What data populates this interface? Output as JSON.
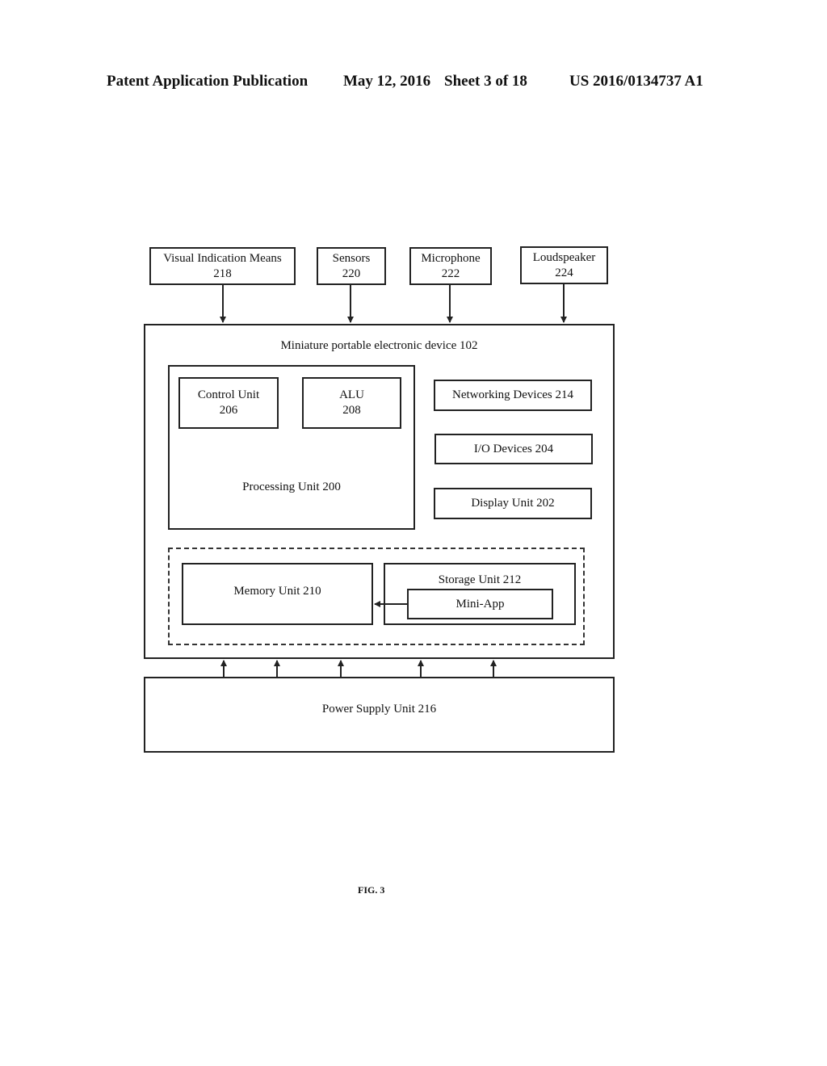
{
  "header": {
    "publication": "Patent Application Publication",
    "date": "May 12, 2016",
    "sheet": "Sheet 3 of 18",
    "number": "US 2016/0134737 A1"
  },
  "inputs": [
    {
      "name": "Visual Indication Means",
      "ref": "218"
    },
    {
      "name": "Sensors",
      "ref": "220"
    },
    {
      "name": "Microphone",
      "ref": "222"
    },
    {
      "name": "Loudspeaker",
      "ref": "224"
    }
  ],
  "device": {
    "title": "Miniature portable electronic device 102",
    "processing_unit": {
      "label": "Processing Unit 200",
      "control_unit": {
        "name": "Control Unit",
        "ref": "206"
      },
      "alu": {
        "name": "ALU",
        "ref": "208"
      }
    },
    "networking": "Networking Devices 214",
    "io": "I/O Devices 204",
    "display": "Display Unit 202",
    "memory": "Memory Unit 210",
    "storage": {
      "label": "Storage Unit 212",
      "mini_app": "Mini-App"
    }
  },
  "power_supply": "Power Supply Unit 216",
  "figure_label": "FIG. 3"
}
